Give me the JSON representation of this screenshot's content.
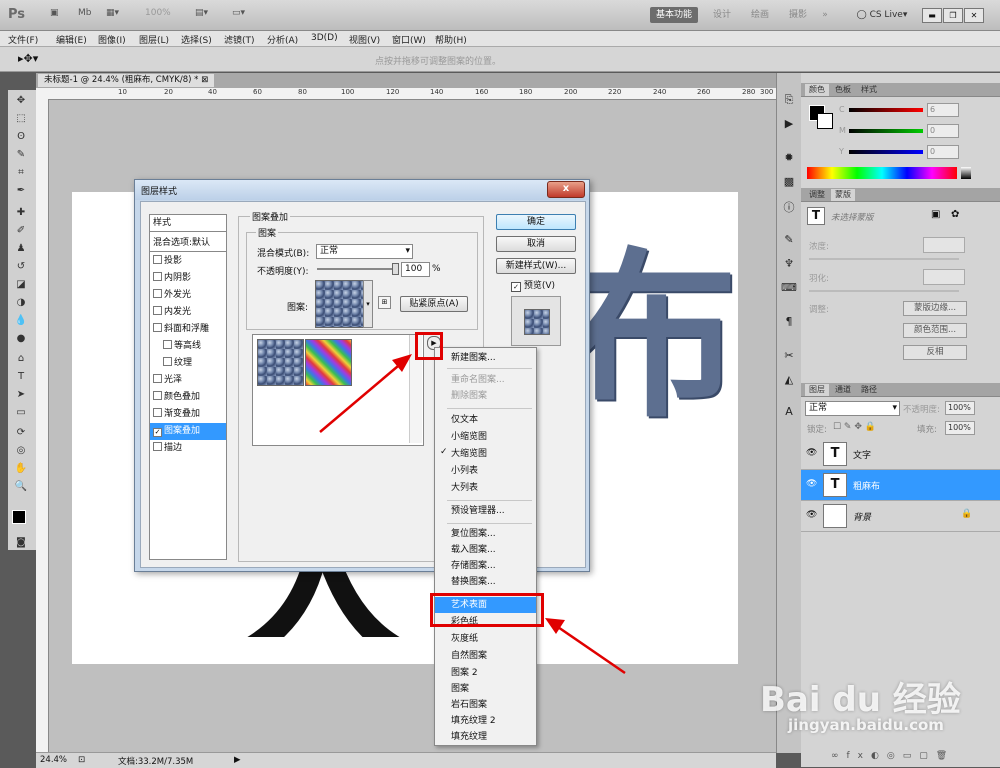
{
  "app": {
    "logo": "Ps",
    "zoom_top": "100%"
  },
  "workspace": {
    "active": "基本功能",
    "items": [
      "设计",
      "绘画",
      "摄影",
      "»"
    ],
    "cslive": "CS Live▾"
  },
  "menus": [
    "文件(F)",
    "编辑(E)",
    "图像(I)",
    "图层(L)",
    "选择(S)",
    "滤镜(T)",
    "分析(A)",
    "3D(D)",
    "视图(V)",
    "窗口(W)",
    "帮助(H)"
  ],
  "options_hint": "点按并拖移可调整图案的位置。",
  "document": {
    "tab": "未标题-1 @ 24.4% (粗麻布, CMYK/8) *",
    "ruler_ticks": [
      "10",
      "20",
      "40",
      "60",
      "80",
      "100",
      "120",
      "140",
      "160",
      "180",
      "200",
      "220",
      "240",
      "260",
      "280",
      "300"
    ],
    "canvas_char_1": "布",
    "canvas_char_2": "大",
    "zoom": "24.4%",
    "doc_size": "文档:33.2M/7.35M"
  },
  "color_panel": {
    "tabs": [
      "颜色",
      "色板",
      "样式"
    ],
    "channels": [
      {
        "label": "C",
        "value": "6"
      },
      {
        "label": "M",
        "value": "0"
      },
      {
        "label": "Y",
        "value": "0"
      }
    ]
  },
  "adjust_panel": {
    "tabs": [
      "调整",
      "蒙版"
    ],
    "no_selection": "未选择蒙版",
    "density": "浓度:",
    "feather": "羽化:",
    "refine": "调整:",
    "btn_edge": "蒙版边缘...",
    "btn_range": "颜色范围...",
    "btn_invert": "反相"
  },
  "layers_panel": {
    "tabs": [
      "图层",
      "通道",
      "路径"
    ],
    "blend_mode": "正常",
    "opacity_label": "不透明度:",
    "opacity_value": "100%",
    "lock_label": "锁定:",
    "fill_label": "填充:",
    "fill_value": "100%",
    "layers": [
      {
        "name": "文字",
        "thumb": "T",
        "selected": false
      },
      {
        "name": "粗麻布",
        "thumb": "T",
        "selected": true
      },
      {
        "name": "背景",
        "thumb": "",
        "selected": false
      }
    ]
  },
  "dialog": {
    "title": "图层样式",
    "close": "x",
    "styles_header": "样式",
    "blend_default": "混合选项:默认",
    "effects": [
      "投影",
      "内阴影",
      "外发光",
      "内发光",
      "斜面和浮雕",
      "等高线",
      "纹理",
      "光泽",
      "颜色叠加",
      "渐变叠加",
      "图案叠加",
      "描边"
    ],
    "selected_effect": "图案叠加",
    "group_title": "图案叠加",
    "sub_group": "图案",
    "blend_mode_label": "混合模式(B):",
    "blend_mode_value": "正常",
    "opacity_label": "不透明度(Y):",
    "opacity_value": "100",
    "opacity_unit": "%",
    "pattern_label": "图案:",
    "snap_button": "贴紧原点(A)",
    "ok": "确定",
    "cancel": "取消",
    "new_style": "新建样式(W)...",
    "preview": "预览(V)"
  },
  "context_menu": {
    "items": [
      {
        "label": "新建图案...",
        "state": "normal"
      },
      {
        "label": "重命名图案...",
        "state": "disabled"
      },
      {
        "label": "删除图案",
        "state": "disabled"
      },
      {
        "label": "仅文本",
        "state": "normal"
      },
      {
        "label": "小缩览图",
        "state": "normal"
      },
      {
        "label": "大缩览图",
        "state": "checked"
      },
      {
        "label": "小列表",
        "state": "normal"
      },
      {
        "label": "大列表",
        "state": "normal"
      },
      {
        "label": "预设管理器...",
        "state": "normal"
      },
      {
        "label": "复位图案...",
        "state": "normal"
      },
      {
        "label": "载入图案...",
        "state": "normal"
      },
      {
        "label": "存储图案...",
        "state": "normal"
      },
      {
        "label": "替换图案...",
        "state": "normal"
      },
      {
        "label": "艺术表面",
        "state": "highlighted"
      },
      {
        "label": "彩色纸",
        "state": "normal"
      },
      {
        "label": "灰度纸",
        "state": "normal"
      },
      {
        "label": "自然图案",
        "state": "normal"
      },
      {
        "label": "图案 2",
        "state": "normal"
      },
      {
        "label": "图案",
        "state": "normal"
      },
      {
        "label": "岩石图案",
        "state": "normal"
      },
      {
        "label": "填充纹理 2",
        "state": "normal"
      },
      {
        "label": "填充纹理",
        "state": "normal"
      }
    ]
  },
  "watermark": {
    "logo": "Bai du 经验",
    "url": "jingyan.baidu.com"
  },
  "colors": {
    "accent": "#3399ff",
    "highlight_box": "#e00000",
    "dialog_frame": "#c6d7ea"
  }
}
